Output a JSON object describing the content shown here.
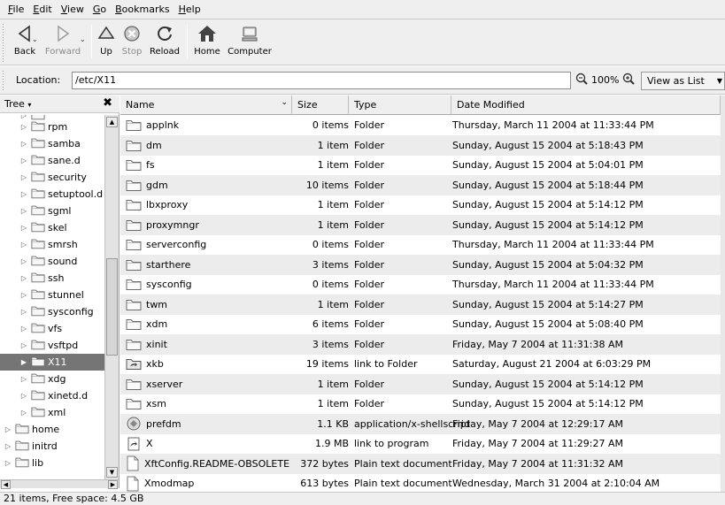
{
  "menubar": [
    "File",
    "Edit",
    "View",
    "Go",
    "Bookmarks",
    "Help"
  ],
  "toolbar": {
    "back": "Back",
    "forward": "Forward",
    "up": "Up",
    "stop": "Stop",
    "reload": "Reload",
    "home": "Home",
    "computer": "Computer"
  },
  "location": {
    "label": "Location:",
    "value": "/etc/X11",
    "zoom": "100%",
    "view_mode": "View as List"
  },
  "sidebar": {
    "title": "Tree",
    "items": [
      {
        "label": "rpm",
        "indent": 2,
        "selected": false
      },
      {
        "label": "samba",
        "indent": 2,
        "selected": false
      },
      {
        "label": "sane.d",
        "indent": 2,
        "selected": false
      },
      {
        "label": "security",
        "indent": 2,
        "selected": false
      },
      {
        "label": "setuptool.d",
        "indent": 2,
        "selected": false
      },
      {
        "label": "sgml",
        "indent": 2,
        "selected": false
      },
      {
        "label": "skel",
        "indent": 2,
        "selected": false
      },
      {
        "label": "smrsh",
        "indent": 2,
        "selected": false
      },
      {
        "label": "sound",
        "indent": 2,
        "selected": false
      },
      {
        "label": "ssh",
        "indent": 2,
        "selected": false
      },
      {
        "label": "stunnel",
        "indent": 2,
        "selected": false
      },
      {
        "label": "sysconfig",
        "indent": 2,
        "selected": false
      },
      {
        "label": "vfs",
        "indent": 2,
        "selected": false
      },
      {
        "label": "vsftpd",
        "indent": 2,
        "selected": false
      },
      {
        "label": "X11",
        "indent": 2,
        "selected": true
      },
      {
        "label": "xdg",
        "indent": 2,
        "selected": false
      },
      {
        "label": "xinetd.d",
        "indent": 2,
        "selected": false
      },
      {
        "label": "xml",
        "indent": 2,
        "selected": false
      },
      {
        "label": "home",
        "indent": 1,
        "selected": false
      },
      {
        "label": "initrd",
        "indent": 1,
        "selected": false
      },
      {
        "label": "lib",
        "indent": 1,
        "selected": false
      }
    ]
  },
  "columns": {
    "name": "Name",
    "size": "Size",
    "type": "Type",
    "date": "Date Modified"
  },
  "files": [
    {
      "name": "applnk",
      "size": "0 items",
      "type": "Folder",
      "date": "Thursday, March 11 2004 at 11:33:44 PM",
      "icon": "folder"
    },
    {
      "name": "dm",
      "size": "1 item",
      "type": "Folder",
      "date": "Sunday, August 15 2004 at 5:18:43 PM",
      "icon": "folder"
    },
    {
      "name": "fs",
      "size": "1 item",
      "type": "Folder",
      "date": "Sunday, August 15 2004 at 5:04:01 PM",
      "icon": "folder"
    },
    {
      "name": "gdm",
      "size": "10 items",
      "type": "Folder",
      "date": "Sunday, August 15 2004 at 5:18:44 PM",
      "icon": "folder"
    },
    {
      "name": "lbxproxy",
      "size": "1 item",
      "type": "Folder",
      "date": "Sunday, August 15 2004 at 5:14:12 PM",
      "icon": "folder"
    },
    {
      "name": "proxymngr",
      "size": "1 item",
      "type": "Folder",
      "date": "Sunday, August 15 2004 at 5:14:12 PM",
      "icon": "folder"
    },
    {
      "name": "serverconfig",
      "size": "0 items",
      "type": "Folder",
      "date": "Thursday, March 11 2004 at 11:33:44 PM",
      "icon": "folder"
    },
    {
      "name": "starthere",
      "size": "3 items",
      "type": "Folder",
      "date": "Sunday, August 15 2004 at 5:04:32 PM",
      "icon": "folder"
    },
    {
      "name": "sysconfig",
      "size": "0 items",
      "type": "Folder",
      "date": "Thursday, March 11 2004 at 11:33:44 PM",
      "icon": "folder"
    },
    {
      "name": "twm",
      "size": "1 item",
      "type": "Folder",
      "date": "Sunday, August 15 2004 at 5:14:27 PM",
      "icon": "folder"
    },
    {
      "name": "xdm",
      "size": "6 items",
      "type": "Folder",
      "date": "Sunday, August 15 2004 at 5:08:40 PM",
      "icon": "folder"
    },
    {
      "name": "xinit",
      "size": "3 items",
      "type": "Folder",
      "date": "Friday, May 7 2004 at 11:31:38 AM",
      "icon": "folder"
    },
    {
      "name": "xkb",
      "size": "19 items",
      "type": "link to Folder",
      "date": "Saturday, August 21 2004 at 6:03:29 PM",
      "icon": "folder-link"
    },
    {
      "name": "xserver",
      "size": "1 item",
      "type": "Folder",
      "date": "Sunday, August 15 2004 at 5:14:12 PM",
      "icon": "folder"
    },
    {
      "name": "xsm",
      "size": "1 item",
      "type": "Folder",
      "date": "Sunday, August 15 2004 at 5:14:12 PM",
      "icon": "folder"
    },
    {
      "name": "prefdm",
      "size": "1.1 KB",
      "type": "application/x-shellscript",
      "date": "Friday, May 7 2004 at 12:29:17 AM",
      "icon": "script"
    },
    {
      "name": "X",
      "size": "1.9 MB",
      "type": "link to program",
      "date": "Friday, May 7 2004 at 11:29:27 AM",
      "icon": "program-link"
    },
    {
      "name": "XftConfig.README-OBSOLETE",
      "size": "372 bytes",
      "type": "Plain text document",
      "date": "Friday, May 7 2004 at 11:31:32 AM",
      "icon": "text-file"
    },
    {
      "name": "Xmodmap",
      "size": "613 bytes",
      "type": "Plain text document",
      "date": "Wednesday, March 31 2004 at 2:10:04 AM",
      "icon": "text-file"
    }
  ],
  "status": "21 items, Free space: 4.5 GB"
}
